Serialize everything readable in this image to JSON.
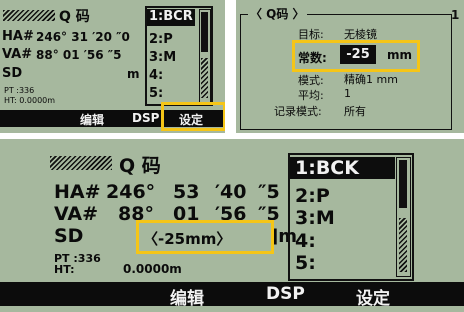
{
  "panel_tl": {
    "title": "Q 码",
    "rows": [
      {
        "label": "HA#",
        "value": "246°  31  ′20  ″0"
      },
      {
        "label": "VA#",
        "value": " 88°  01  ′56  ″5"
      },
      {
        "label": "SD",
        "value": "m"
      }
    ],
    "pt": "PT :336",
    "ht": "HT:        0.0000m",
    "menu": [
      "1:BCR",
      "2:P",
      "3:M",
      "4:",
      "5:"
    ],
    "softkeys": [
      "编辑",
      "DSP",
      "设定"
    ]
  },
  "panel_tr": {
    "title": "〈 Q码 〉",
    "corner": "1",
    "fields": [
      {
        "label": "目标:",
        "value": "无棱镜"
      },
      {
        "label": "常数:",
        "value": "-25",
        "unit": "mm"
      },
      {
        "label": "模式:",
        "value": "精确1 mm"
      },
      {
        "label": "平均:",
        "value": "1"
      },
      {
        "label": "记录模式:",
        "value": "所有"
      }
    ]
  },
  "panel_bot": {
    "title": "Q 码",
    "rows": [
      {
        "label": "HA#",
        "d": "246°",
        "m": "53",
        "s": "′40",
        "t": "″5"
      },
      {
        "label": "VA#",
        "d": "88°",
        "m": "01",
        "s": "′56",
        "t": "″5"
      }
    ],
    "sd_label": "SD",
    "sd_value": "〈-25mm〉",
    "sd_unit": "]m",
    "pt": "PT :336",
    "ht": "HT:",
    "ht_value": "0.0000m",
    "menu": [
      "1:BCK",
      "2:P",
      "3:M",
      "4:",
      "5:"
    ],
    "softkeys": [
      "编辑",
      "DSP",
      "设定"
    ]
  },
  "colors": {
    "lcd": "#a6b89e",
    "highlight": "#f5c517",
    "dark": "#0c0c0c"
  }
}
